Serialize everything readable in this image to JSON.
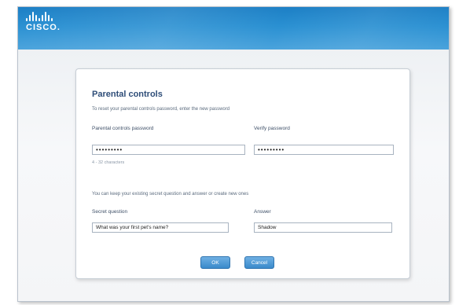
{
  "brand": {
    "name": "CISCO."
  },
  "dialog": {
    "title": "Parental controls",
    "intro": "To reset your parental controls password, enter the new password",
    "password_label": "Parental controls password",
    "password_value": "•••••••••",
    "verify_label": "Verify password",
    "verify_value": "•••••••••",
    "password_hint": "4 - 32 characters",
    "secret_intro": "You can keep your existing secret question and answer or create new ones",
    "question_label": "Secret question",
    "question_value": "What was your first pet's name?",
    "answer_label": "Answer",
    "answer_value": "Shadow",
    "ok_label": "OK",
    "cancel_label": "Cancel"
  }
}
